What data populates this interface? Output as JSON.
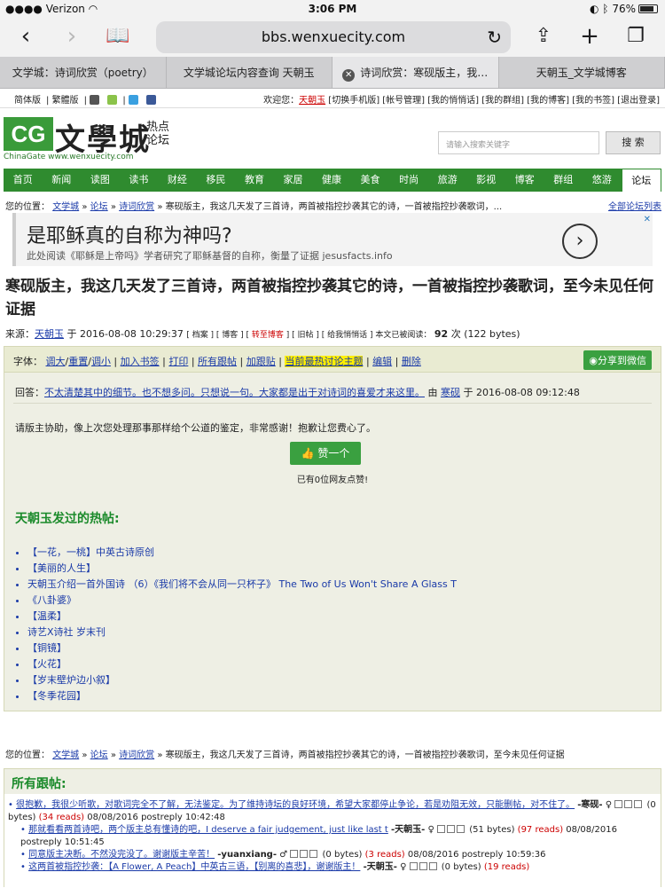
{
  "status": {
    "carrier": "Verizon",
    "time": "3:06 PM",
    "battery": "76%"
  },
  "browser": {
    "url": "bbs.wenxuecity.com"
  },
  "tabs": [
    {
      "label": "文学城：诗词欣赏（poetry）"
    },
    {
      "label": "文学城论坛内容查询 天朝玉"
    },
    {
      "label": "诗词欣赏：寒砚版主，我…"
    },
    {
      "label": "天朝玉_文学城博客"
    }
  ],
  "util": {
    "simplified": "简体版",
    "traditional": "繁體版",
    "welcome": "欢迎您：",
    "user": "天朝玉",
    "links": "[切换手机版] [帐号管理] [我的悄悄话] [我的群组] [我的博客] [我的书签] [退出登录]"
  },
  "logo": {
    "cg": "CG",
    "zh": "文學城",
    "hot1": "热点",
    "hot2": "论坛",
    "sub": "ChinaGate  www.wenxuecity.com"
  },
  "search": {
    "placeholder": "请输入搜索关键字",
    "button": "搜 索"
  },
  "nav": [
    "首页",
    "新闻",
    "读图",
    "读书",
    "财经",
    "移民",
    "教育",
    "家居",
    "健康",
    "美食",
    "时尚",
    "旅游",
    "影视",
    "博客",
    "群组",
    "悠游",
    "论坛"
  ],
  "crumb": {
    "label": "您的位置：",
    "l1": "文学城",
    "l2": "论坛",
    "l3": "诗词欣赏",
    "tail": "寒砚版主，我这几天发了三首诗，两首被指控抄袭其它的诗，一首被指控抄袭歌词，...",
    "all": "全部论坛列表"
  },
  "ad": {
    "title": "是耶稣真的自称为神吗?",
    "sub": "此处阅读《耶稣是上帝吗》学者研究了耶稣基督的自称，衡量了证据 jesusfacts.info"
  },
  "post": {
    "title": "寒砚版主，我这几天发了三首诗，两首被指控抄袭其它的诗，一首被指控抄袭歌词，至今未见任何证据",
    "source": "来源：",
    "author": "天朝玉",
    "at": "于",
    "date": "2016-08-08 10:29:37",
    "links": "[ 档案 ] [ 博客 ] [ ",
    "links_red": "转至博客",
    "links2": " ] [ 旧帖 ] [ 给我悄悄话 ] 本文已被阅读：",
    "reads": "92",
    "reads_tail": "次 (122 bytes)"
  },
  "tools": {
    "font": "字体：",
    "big": "调大",
    "reset": "重置",
    "small": "调小",
    "bookmark": "加入书签",
    "print": "打印",
    "all_followups": "所有跟帖",
    "add": "加跟贴",
    "hot": "当前最热讨论主题",
    "edit": "编辑",
    "delete": "删除",
    "share": "分享到微信"
  },
  "reply": {
    "prefix": "回答：",
    "link": "不太清楚其中的细节。也不想多问。只想说一句。大家都是出于对诗词的喜爱才来这里。",
    "by": "由",
    "user": "寒砚",
    "at": "于",
    "date": "2016-08-08 09:12:48"
  },
  "body": "请版主协助，像上次您处理那事那样给个公道的鉴定，非常感谢！抱歉让您费心了。",
  "like": {
    "label": "赞一个",
    "count": "已有0位网友点赞!"
  },
  "hot": {
    "title": "天朝玉发过的热帖:",
    "items": [
      "【一花，一桃】中英古诗原创",
      "【美丽的人生】",
      "天朝玉介绍一首外国诗 （6）《我们将不会从同一只杯子》 The Two of Us Won't Share A Glass T",
      "《八卦婆》",
      "【温柔】",
      "诗艺X诗社 岁末刊",
      "【铜镜】",
      "【火花】",
      "【岁末壁炉边小叙】",
      "【冬季花园】"
    ]
  },
  "crumb2": {
    "label": "您的位置：",
    "l1": "文学城",
    "l2": "论坛",
    "l3": "诗词欣赏",
    "tail": "寒砚版主，我这几天发了三首诗，两首被指控抄袭其它的诗，一首被指控抄袭歌词，至今未见任何证据"
  },
  "followups": {
    "title": "所有跟帖:",
    "rows": [
      {
        "text": "很抱歉，我很少听歌，对歌词完全不了解，无法鉴定。为了维持诗坛的良好环境，希望大家都停止争论，若是劝阻无效，只能删帖，对不住了。",
        "author": "-寒砚-",
        "bytes": "(0 bytes)",
        "reads": "(34 reads)",
        "date": "08/08/2016 postreply 10:42:48"
      },
      {
        "text": "那就看看两首诗吧，两个版主总有懂诗的吧，I deserve a fair judgement, just like last t",
        "author": "-天朝玉-",
        "bytes": "(51 bytes)",
        "reads": "(97 reads)",
        "date": "08/08/2016 postreply 10:51:45"
      },
      {
        "text": "同意版主决断。不然没完没了。谢谢版主辛苦！",
        "author": "-yuanxiang-",
        "bytes": "(0 bytes)",
        "reads": "(3 reads)",
        "date": "08/08/2016 postreply 10:59:36"
      },
      {
        "text": "这两首被指控抄袭：【A Flower, A Peach】中英古三语，【别离的喜悲】，谢谢版主！",
        "author": "-天朝玉-",
        "bytes": "(0 bytes)",
        "reads": "(19 reads)",
        "date": ""
      }
    ]
  }
}
